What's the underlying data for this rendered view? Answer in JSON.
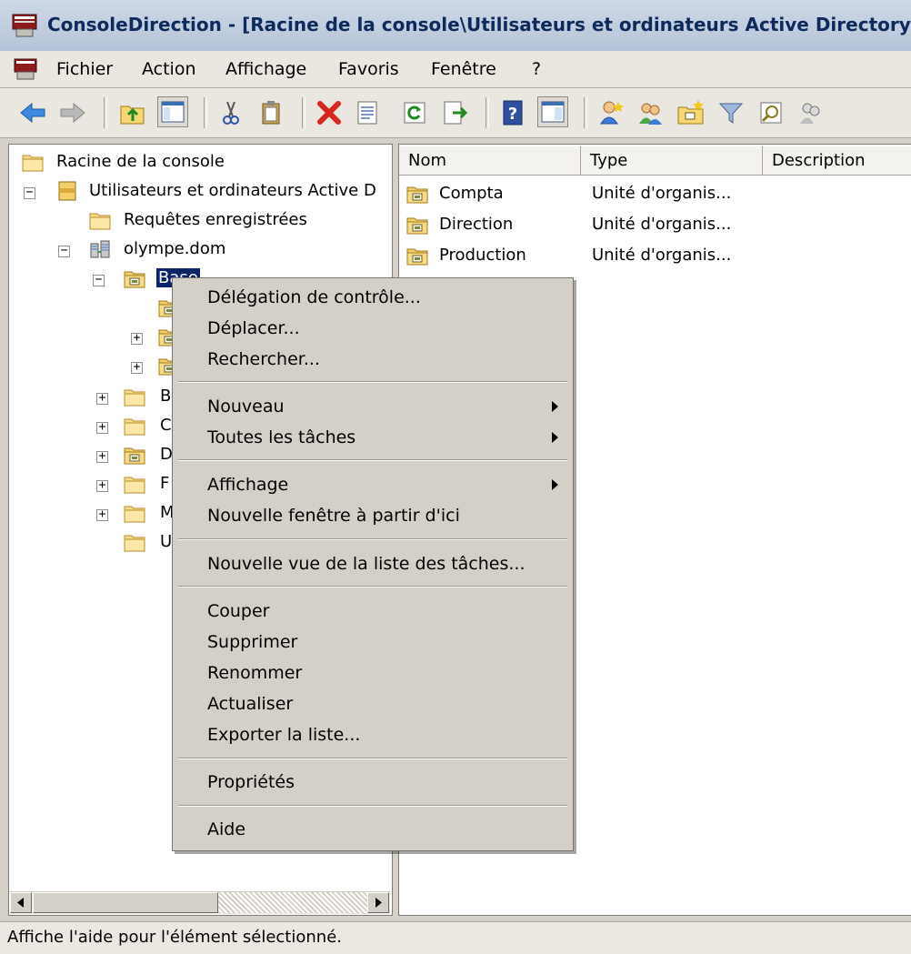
{
  "window": {
    "title": "ConsoleDirection - [Racine de la console\\Utilisateurs et ordinateurs Active Directory"
  },
  "menubar": {
    "items": [
      "Fichier",
      "Action",
      "Affichage",
      "Favoris",
      "Fenêtre",
      "?"
    ]
  },
  "toolbar": {
    "buttons": [
      "back-arrow-icon",
      "forward-arrow-icon",
      "up-folder-icon",
      "show-hide-tree-icon",
      "cut-icon",
      "paste-icon",
      "delete-icon",
      "properties-icon",
      "refresh-icon",
      "export-list-icon",
      "help-icon",
      "action-pane-icon",
      "new-user-icon",
      "new-group-icon",
      "new-ou-icon",
      "filter-icon",
      "find-icon",
      "add-to-group-icon"
    ]
  },
  "tree": {
    "root": "Racine de la console",
    "aduc": "Utilisateurs et ordinateurs Active D",
    "saved_queries": "Requêtes enregistrées",
    "domain": "olympe.dom",
    "selected_ou": "Base",
    "ou_partial": [
      "B",
      "C",
      "D",
      "F",
      "M",
      "U"
    ]
  },
  "list": {
    "columns": [
      "Nom",
      "Type",
      "Description"
    ],
    "rows": [
      {
        "name": "Compta",
        "type": "Unité d'organis..."
      },
      {
        "name": "Direction",
        "type": "Unité d'organis..."
      },
      {
        "name": "Production",
        "type": "Unité d'organis..."
      }
    ]
  },
  "context_menu": {
    "delegation": "Délégation de contrôle...",
    "move": "Déplacer...",
    "find": "Rechercher...",
    "new": "Nouveau",
    "all_tasks": "Toutes les tâches",
    "view": "Affichage",
    "new_window": "Nouvelle fenêtre à partir d'ici",
    "new_taskpad": "Nouvelle vue de la liste des tâches...",
    "cut": "Couper",
    "delete": "Supprimer",
    "rename": "Renommer",
    "refresh": "Actualiser",
    "export": "Exporter la liste...",
    "properties": "Propriétés",
    "help": "Aide"
  },
  "statusbar": {
    "text": "Affiche l'aide pour l'élément sélectionné."
  },
  "colors": {
    "selection": "#0a246a",
    "titlebar_text": "#0d2a5c",
    "window_bg": "#d4d0c8",
    "folder": "#e8c869"
  }
}
